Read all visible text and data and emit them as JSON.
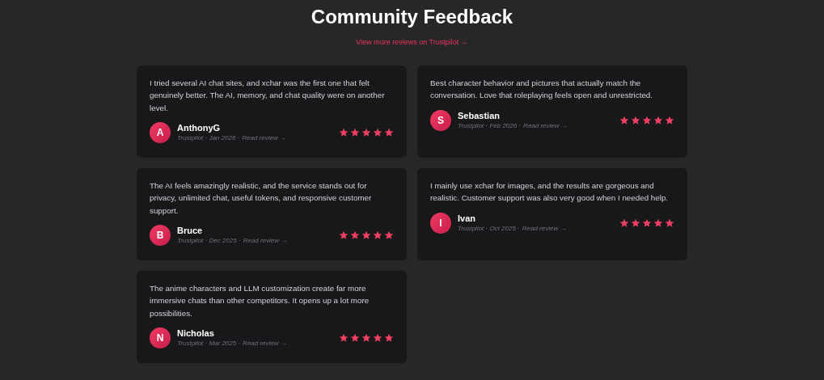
{
  "title": "Community Feedback",
  "more_link": "View more reviews on Trustpilot →",
  "reviews": [
    {
      "text": "I tried several AI chat sites, and xchar was the first one that felt genuinely better. The AI, memory, and chat quality were on another level.",
      "initial": "A",
      "name": "AnthonyG",
      "meta": "Trustpilot · Jan 2026 ·",
      "link": "Read review →",
      "stars": 5
    },
    {
      "text": "Best character behavior and pictures that actually match the conversation. Love that roleplaying feels open and unrestricted.",
      "initial": "S",
      "name": "Sebastian",
      "meta": "Trustpilot · Feb 2026 ·",
      "link": "Read review →",
      "stars": 5
    },
    {
      "text": "The AI feels amazingly realistic, and the service stands out for privacy, unlimited chat, useful tokens, and responsive customer support.",
      "initial": "B",
      "name": "Bruce",
      "meta": "Trustpilot · Dec 2025 ·",
      "link": "Read review →",
      "stars": 5
    },
    {
      "text": "I mainly use xchar for images, and the results are gorgeous and realistic. Customer support was also very good when I needed help.",
      "initial": "I",
      "name": "Ivan",
      "meta": "Trustpilot · Oct 2025 ·",
      "link": "Read review →",
      "stars": 5
    },
    {
      "text": "The anime characters and LLM customization create far more immersive chats than other competitors. It opens up a lot more possibilities.",
      "initial": "N",
      "name": "Nicholas",
      "meta": "Trustpilot · Mar 2025 ·",
      "link": "Read review →",
      "stars": 5
    }
  ]
}
